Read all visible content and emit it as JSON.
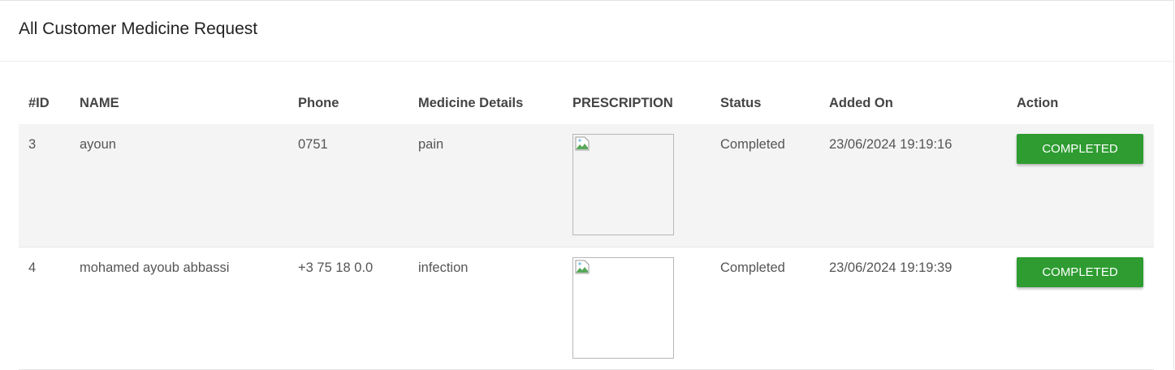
{
  "page": {
    "title": "All Customer Medicine Request"
  },
  "table": {
    "headers": {
      "id": "#ID",
      "name": "NAME",
      "phone": "Phone",
      "details": "Medicine Details",
      "prescription": "PRESCRIPTION",
      "status": "Status",
      "added_on": "Added On",
      "action": "Action"
    },
    "rows": [
      {
        "id": "3",
        "name": "ayoun",
        "phone": "0751",
        "details": "pain",
        "prescription_icon": "broken-image-icon",
        "status": "Completed",
        "added_on": "23/06/2024 19:19:16",
        "action_label": "Completed"
      },
      {
        "id": "4",
        "name": "mohamed ayoub abbassi",
        "phone": "+3 75 18 0.0",
        "details": "infection",
        "prescription_icon": "broken-image-icon",
        "status": "Completed",
        "added_on": "23/06/2024 19:19:39",
        "action_label": "Completed"
      }
    ]
  },
  "colors": {
    "action_button": "#2e9c31",
    "striped_row": "#f4f4f4"
  }
}
